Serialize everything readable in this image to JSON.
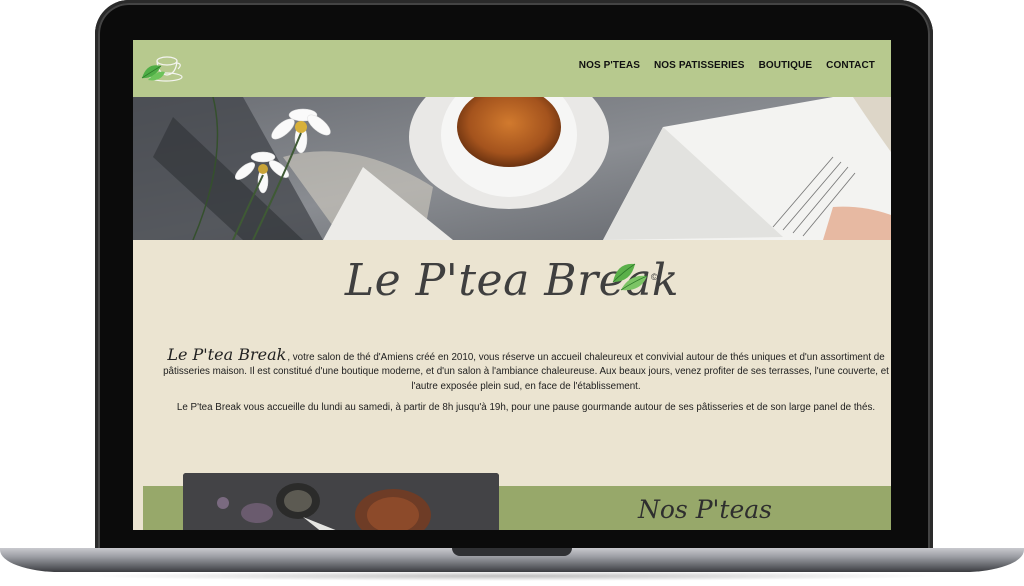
{
  "nav": {
    "items": [
      {
        "label": "NOS P'TEAS"
      },
      {
        "label": "NOS PATISSERIES"
      },
      {
        "label": "BOUTIQUE"
      },
      {
        "label": "CONTACT"
      }
    ]
  },
  "brand": {
    "title": "Le P'tea Break",
    "copyright": "©"
  },
  "intro": {
    "brand_inline": "Le P'tea Break",
    "paragraph1": ", votre salon de thé d'Amiens créé en 2010, vous réserve un accueil chaleureux et convivial autour de thés uniques et d'un assortiment de pâtisseries maison. Il est constitué d'une boutique moderne, et d'un salon à l'ambiance chaleureuse. Aux beaux jours, venez profiter de ses terrasses, l'une couverte, et l'autre exposée plein sud, en face de l'établissement.",
    "paragraph2": "Le P'tea Break vous accueille du lundi au samedi, à partir de 8h jusqu'à 19h, pour une pause gourmande autour de ses pâtisseries et de son large panel de thés."
  },
  "section": {
    "title": "Nos P'teas"
  },
  "colors": {
    "navbar": "#b7c98e",
    "page_bg": "#ebe4d1",
    "section_band": "#97a86a",
    "leaf_green": "#5bb04a",
    "text_dark": "#1e1e1e"
  },
  "icons": {
    "logo": "teacup-leaf-logo",
    "brand_mark": "leaf-icon"
  }
}
